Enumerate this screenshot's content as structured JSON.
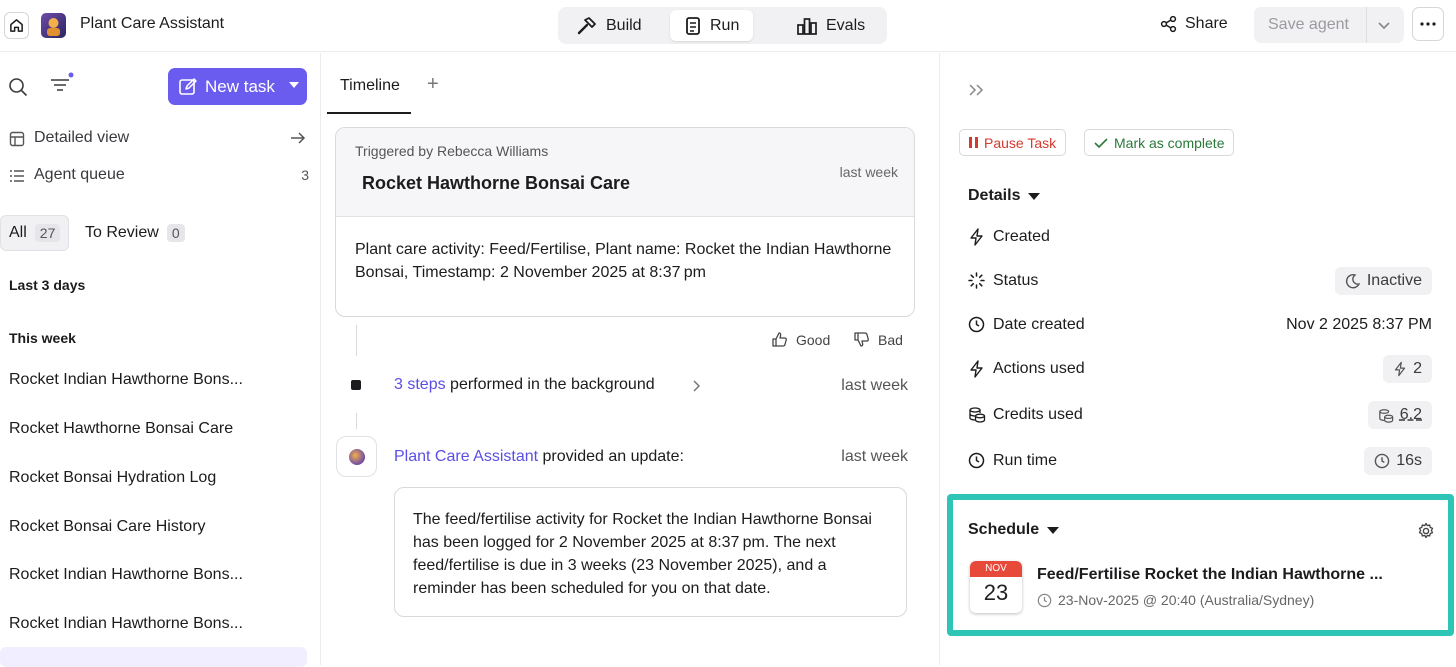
{
  "header": {
    "app_title": "Plant Care Assistant",
    "modes": [
      {
        "label": "Build",
        "icon": "hammer-icon"
      },
      {
        "label": "Run",
        "icon": "clipboard-icon",
        "active": true
      },
      {
        "label": "Evals",
        "icon": "bar-chart-icon"
      }
    ],
    "share_label": "Share",
    "save_label": "Save agent"
  },
  "sidebar": {
    "new_task_label": "New task",
    "links": [
      {
        "label": "Detailed view",
        "icon": "layout-icon"
      },
      {
        "label": "Agent queue",
        "icon": "list-icon",
        "count": "3"
      }
    ],
    "filters": [
      {
        "label": "All",
        "count": "27",
        "active": true
      },
      {
        "label": "To Review",
        "count": "0"
      }
    ],
    "sections": [
      {
        "heading": "Last 3 days",
        "items": []
      },
      {
        "heading": "This week",
        "items": [
          "Rocket Indian Hawthorne Bons...",
          "Rocket Hawthorne Bonsai Care",
          "Rocket Bonsai Hydration Log",
          "Rocket Bonsai Care History",
          "Rocket Indian Hawthorne Bons...",
          "Rocket Indian Hawthorne Bons..."
        ]
      }
    ]
  },
  "timeline": {
    "tab_label": "Timeline",
    "add_tab_label": "+",
    "trigger": {
      "triggered_by": "Triggered by Rebecca Williams",
      "title": "Rocket Hawthorne Bonsai Care",
      "time": "last week",
      "body": "Plant care activity: Feed/Fertilise, Plant name: Rocket the Indian Hawthorne Bonsai, Timestamp: 2 November 2025 at 8:37 pm"
    },
    "feedback": {
      "good": "Good",
      "bad": "Bad"
    },
    "steps": {
      "link": "3 steps",
      "text": " performed in the background",
      "time": "last week"
    },
    "update": {
      "agent": "Plant Care Assistant",
      "text": " provided an update:",
      "time": "last week",
      "message": "The feed/fertilise activity for Rocket the Indian Hawthorne Bonsai has been logged for 2 November 2025 at 8:37 pm. The next feed/fertilise is due in 3 weeks (23 November 2025), and a reminder has been scheduled for you on that date."
    }
  },
  "details": {
    "pause_label": "Pause Task",
    "complete_label": "Mark as complete",
    "heading": "Details",
    "rows": [
      {
        "label": "Created",
        "icon": "bolt-icon",
        "value": ""
      },
      {
        "label": "Status",
        "icon": "loader-icon",
        "value": "Inactive",
        "chip_icon": "moon-icon"
      },
      {
        "label": "Date created",
        "icon": "clock-icon",
        "value": "Nov 2 2025 8:37 PM"
      },
      {
        "label": "Actions used",
        "icon": "bolt-icon",
        "value": "2",
        "chip_icon": "bolt-icon"
      },
      {
        "label": "Credits used",
        "icon": "coins-icon",
        "value": "6.2",
        "chip_icon": "coins-icon"
      },
      {
        "label": "Run time",
        "icon": "clock-icon",
        "value": "16s",
        "chip_icon": "clock-icon"
      }
    ],
    "schedule": {
      "heading": "Schedule",
      "month": "NOV",
      "day": "23",
      "title": "Feed/Fertilise Rocket the Indian Hawthorne ...",
      "when": "23-Nov-2025 @ 20:40 (Australia/Sydney)"
    }
  },
  "colors": {
    "accent": "#6b5cf0",
    "highlight": "#2ec4b6",
    "danger": "#d43a2f",
    "success": "#2a7a3b"
  }
}
